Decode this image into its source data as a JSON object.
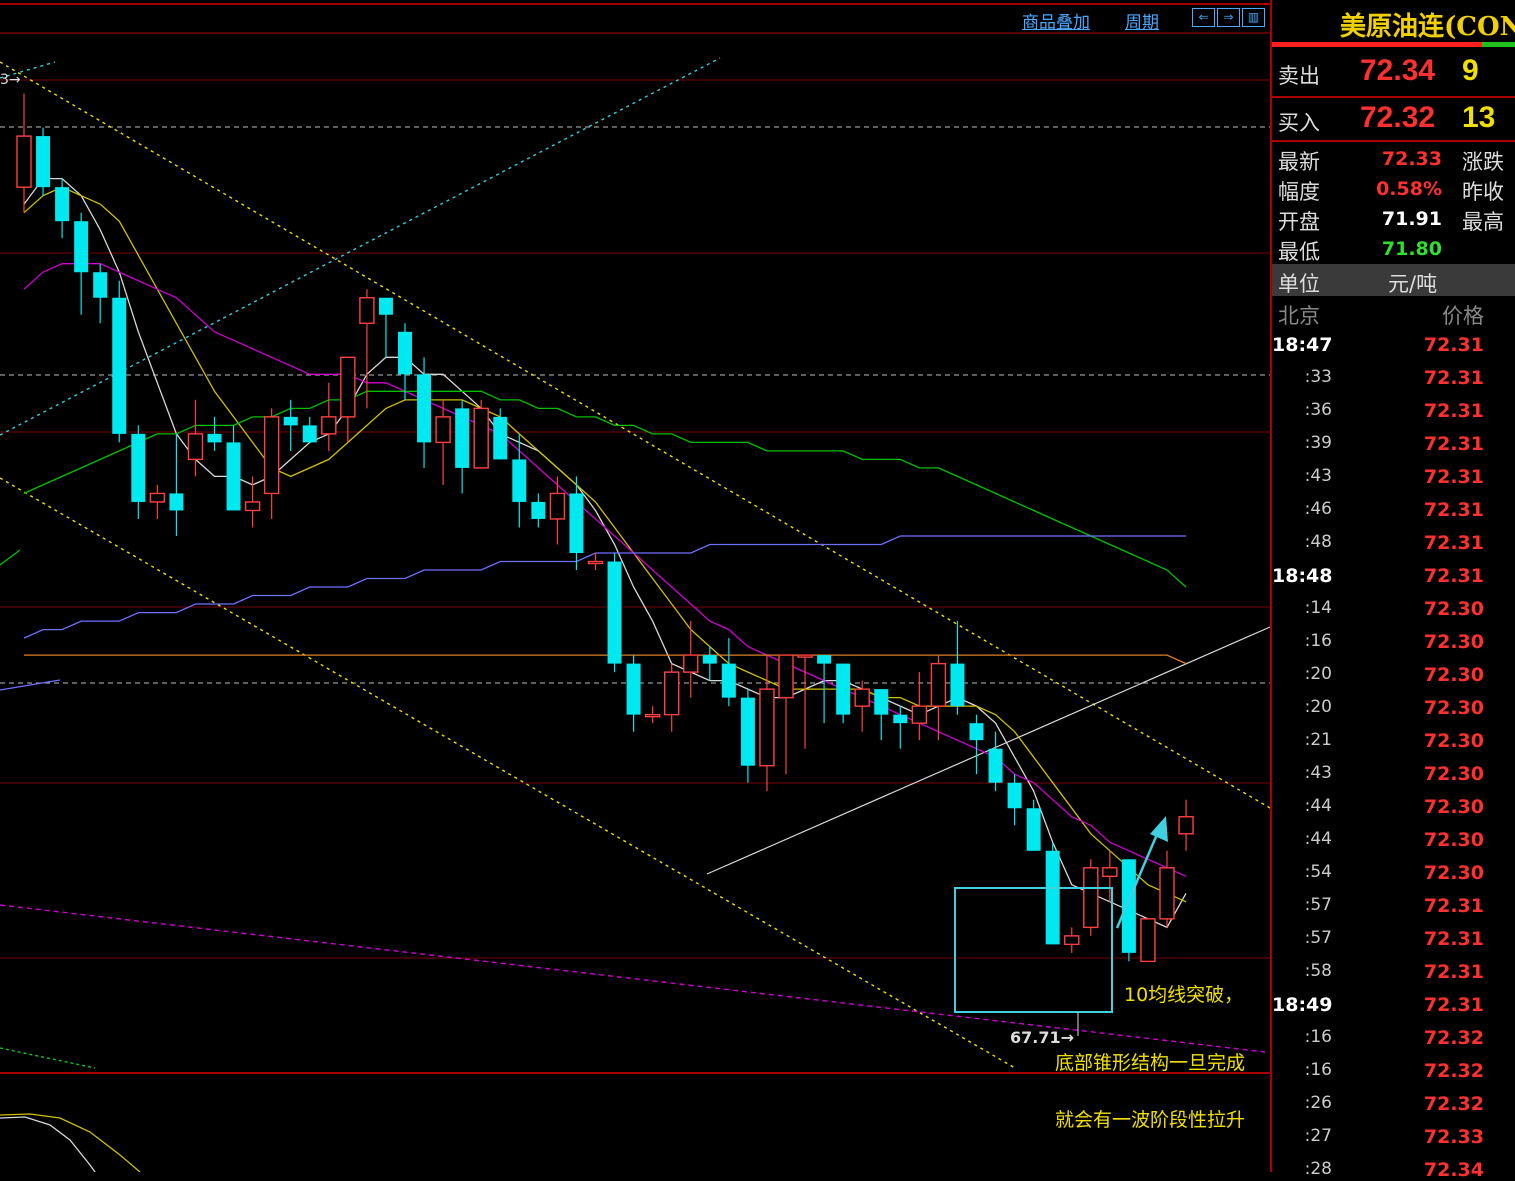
{
  "toolbar": {
    "overlay_label": "商品叠加",
    "period_label": "周期"
  },
  "chart": {
    "low_marker": "67.71→",
    "annotations": [
      "10均线突破，",
      "底部锥形结构一旦完成",
      "就会有一波阶段性拉升"
    ],
    "colors": {
      "up": "#ff4040",
      "down": "#00e8f0",
      "ma5": "#d8d8d8",
      "ma10": "#d0c000",
      "ma20": "#d000d0",
      "ma60": "#00c000",
      "ma120": "#7070ff",
      "ma250": "#e08020",
      "channel": "#f0e000",
      "box": "#40d0e0"
    }
  },
  "chart_data": {
    "type": "candlestick",
    "ylim": [
      66.4,
      78.6
    ],
    "candles": [
      [
        76.8,
        77.4,
        76.5,
        77.9
      ],
      [
        77.4,
        76.8,
        76.7,
        77.5
      ],
      [
        76.8,
        76.4,
        76.2,
        76.9
      ],
      [
        76.4,
        75.8,
        75.3,
        76.5
      ],
      [
        75.8,
        75.5,
        75.2,
        75.9
      ],
      [
        75.5,
        73.9,
        73.8,
        75.7
      ],
      [
        73.9,
        73.1,
        72.9,
        74.0
      ],
      [
        73.1,
        73.2,
        72.9,
        73.3
      ],
      [
        73.2,
        73.0,
        72.7,
        73.9
      ],
      [
        73.6,
        73.9,
        73.4,
        74.3
      ],
      [
        73.9,
        73.8,
        73.7,
        74.1
      ],
      [
        73.8,
        73.0,
        73.0,
        74.0
      ],
      [
        73.0,
        73.1,
        72.8,
        73.4
      ],
      [
        73.2,
        74.1,
        72.9,
        74.2
      ],
      [
        74.1,
        74.0,
        73.7,
        74.3
      ],
      [
        74.0,
        73.8,
        73.8,
        74.1
      ],
      [
        73.9,
        74.1,
        73.7,
        74.5
      ],
      [
        74.1,
        74.8,
        73.8,
        74.8
      ],
      [
        75.2,
        75.5,
        74.2,
        75.6
      ],
      [
        75.5,
        75.3,
        74.8,
        75.5
      ],
      [
        75.1,
        74.6,
        74.3,
        75.2
      ],
      [
        74.6,
        73.8,
        73.5,
        74.8
      ],
      [
        73.8,
        74.1,
        73.3,
        74.3
      ],
      [
        74.2,
        73.5,
        73.2,
        74.3
      ],
      [
        73.5,
        74.2,
        73.5,
        74.3
      ],
      [
        74.1,
        73.6,
        73.6,
        74.2
      ],
      [
        73.6,
        73.1,
        72.8,
        73.9
      ],
      [
        73.1,
        72.9,
        72.8,
        73.2
      ],
      [
        72.9,
        73.2,
        72.6,
        73.4
      ],
      [
        73.2,
        72.5,
        72.3,
        73.4
      ],
      [
        72.4,
        72.4,
        72.3,
        72.5
      ],
      [
        72.4,
        71.2,
        71.1,
        72.5
      ],
      [
        71.2,
        70.6,
        70.4,
        71.3
      ],
      [
        70.6,
        70.6,
        70.5,
        70.7
      ],
      [
        70.6,
        71.1,
        70.4,
        71.2
      ],
      [
        71.1,
        71.3,
        70.8,
        71.7
      ],
      [
        71.3,
        71.2,
        71.0,
        71.4
      ],
      [
        71.2,
        70.8,
        70.7,
        71.5
      ],
      [
        70.8,
        70.0,
        69.8,
        70.9
      ],
      [
        70.0,
        70.9,
        69.7,
        71.3
      ],
      [
        70.8,
        71.3,
        69.9,
        71.3
      ],
      [
        71.3,
        71.3,
        70.2,
        71.3
      ],
      [
        71.3,
        71.2,
        70.5,
        71.3
      ],
      [
        71.2,
        70.6,
        70.5,
        71.2
      ],
      [
        70.7,
        70.9,
        70.4,
        71.0
      ],
      [
        70.9,
        70.6,
        70.3,
        70.9
      ],
      [
        70.6,
        70.5,
        70.2,
        70.7
      ],
      [
        70.5,
        70.7,
        70.3,
        71.1
      ],
      [
        70.7,
        71.2,
        70.3,
        71.3
      ],
      [
        71.2,
        70.7,
        70.6,
        71.7
      ],
      [
        70.5,
        70.3,
        69.9,
        70.6
      ],
      [
        70.2,
        69.8,
        69.7,
        70.4
      ],
      [
        69.8,
        69.5,
        69.3,
        69.9
      ],
      [
        69.5,
        69.0,
        69.0,
        69.6
      ],
      [
        69.0,
        67.9,
        67.9,
        69.1
      ],
      [
        67.9,
        68.0,
        67.8,
        68.1
      ],
      [
        68.1,
        68.8,
        68.0,
        68.9
      ],
      [
        68.7,
        68.8,
        68.4,
        69.0
      ],
      [
        68.9,
        67.8,
        67.7,
        68.9
      ],
      [
        67.7,
        68.2,
        67.7,
        68.2
      ],
      [
        68.2,
        68.8,
        68.1,
        69.0
      ],
      [
        69.2,
        69.4,
        69.0,
        69.6
      ]
    ],
    "ma_series": [
      {
        "name": "MA5",
        "color": "#d8d8d8",
        "values": [
          76.6,
          76.9,
          76.9,
          76.7,
          76.3,
          75.8,
          75.1,
          74.5,
          73.9,
          73.6,
          73.4,
          73.4,
          73.3,
          73.4,
          73.6,
          73.8,
          73.9,
          74.2,
          74.6,
          74.8,
          74.8,
          74.6,
          74.6,
          74.4,
          74.2,
          73.9,
          73.8,
          73.7,
          73.5,
          73.3,
          73.0,
          72.6,
          72.1,
          71.7,
          71.2,
          71.1,
          71.0,
          71.0,
          70.9,
          70.8,
          70.8,
          70.9,
          71.0,
          71.0,
          70.9,
          70.8,
          70.7,
          70.6,
          70.7,
          70.8,
          70.7,
          70.5,
          70.1,
          69.7,
          69.1,
          68.6,
          68.5,
          68.4,
          68.3,
          68.2,
          68.1,
          68.5
        ]
      },
      {
        "name": "MA10",
        "color": "#d0c000",
        "values": [
          76.5,
          76.7,
          76.8,
          76.7,
          76.6,
          76.4,
          76.0,
          75.6,
          75.2,
          74.8,
          74.4,
          74.1,
          73.8,
          73.5,
          73.4,
          73.5,
          73.6,
          73.8,
          74.0,
          74.2,
          74.3,
          74.3,
          74.3,
          74.3,
          74.2,
          74.1,
          73.9,
          73.7,
          73.5,
          73.3,
          73.1,
          72.8,
          72.5,
          72.2,
          71.9,
          71.6,
          71.4,
          71.2,
          71.1,
          71.0,
          70.9,
          70.9,
          70.9,
          70.9,
          70.9,
          70.8,
          70.8,
          70.7,
          70.7,
          70.7,
          70.7,
          70.6,
          70.4,
          70.1,
          69.8,
          69.5,
          69.2,
          69.0,
          68.8,
          68.6,
          68.5,
          68.4
        ]
      },
      {
        "name": "MA20",
        "color": "#d000d0",
        "values": [
          75.6,
          75.8,
          75.9,
          75.9,
          75.9,
          75.8,
          75.7,
          75.6,
          75.5,
          75.3,
          75.1,
          75.0,
          74.9,
          74.8,
          74.7,
          74.6,
          74.6,
          74.6,
          74.5,
          74.5,
          74.4,
          74.3,
          74.2,
          74.1,
          74.0,
          73.9,
          73.7,
          73.5,
          73.3,
          73.1,
          72.9,
          72.7,
          72.5,
          72.3,
          72.1,
          71.9,
          71.7,
          71.6,
          71.4,
          71.3,
          71.2,
          71.1,
          71.0,
          70.9,
          70.8,
          70.7,
          70.6,
          70.5,
          70.4,
          70.3,
          70.2,
          70.1,
          69.9,
          69.8,
          69.6,
          69.4,
          69.3,
          69.1,
          69.0,
          68.9,
          68.8,
          68.7
        ]
      },
      {
        "name": "MA60",
        "color": "#00c000",
        "values": [
          73.2,
          73.3,
          73.4,
          73.5,
          73.6,
          73.7,
          73.8,
          73.9,
          73.9,
          74.0,
          74.0,
          74.0,
          74.1,
          74.1,
          74.2,
          74.2,
          74.3,
          74.3,
          74.4,
          74.4,
          74.4,
          74.4,
          74.4,
          74.4,
          74.4,
          74.3,
          74.3,
          74.2,
          74.2,
          74.1,
          74.1,
          74.0,
          74.0,
          73.9,
          73.9,
          73.8,
          73.8,
          73.8,
          73.8,
          73.7,
          73.7,
          73.7,
          73.7,
          73.7,
          73.6,
          73.6,
          73.6,
          73.5,
          73.5,
          73.4,
          73.3,
          73.2,
          73.1,
          73.0,
          72.9,
          72.8,
          72.7,
          72.6,
          72.5,
          72.4,
          72.3,
          72.1
        ]
      },
      {
        "name": "MA120",
        "color": "#7070ff",
        "values": [
          71.5,
          71.6,
          71.6,
          71.7,
          71.7,
          71.7,
          71.8,
          71.8,
          71.8,
          71.9,
          71.9,
          71.9,
          72.0,
          72.0,
          72.0,
          72.1,
          72.1,
          72.1,
          72.2,
          72.2,
          72.2,
          72.3,
          72.3,
          72.3,
          72.3,
          72.4,
          72.4,
          72.4,
          72.4,
          72.4,
          72.5,
          72.5,
          72.5,
          72.5,
          72.5,
          72.5,
          72.6,
          72.6,
          72.6,
          72.6,
          72.6,
          72.6,
          72.6,
          72.6,
          72.6,
          72.6,
          72.7,
          72.7,
          72.7,
          72.7,
          72.7,
          72.7,
          72.7,
          72.7,
          72.7,
          72.7,
          72.7,
          72.7,
          72.7,
          72.7,
          72.7,
          72.7
        ]
      },
      {
        "name": "MA250",
        "color": "#e08020",
        "values": [
          71.3,
          71.3,
          71.3,
          71.3,
          71.3,
          71.3,
          71.3,
          71.3,
          71.3,
          71.3,
          71.3,
          71.3,
          71.3,
          71.3,
          71.3,
          71.3,
          71.3,
          71.3,
          71.3,
          71.3,
          71.3,
          71.3,
          71.3,
          71.3,
          71.3,
          71.3,
          71.3,
          71.3,
          71.3,
          71.3,
          71.3,
          71.3,
          71.3,
          71.3,
          71.3,
          71.3,
          71.3,
          71.3,
          71.3,
          71.3,
          71.3,
          71.3,
          71.3,
          71.3,
          71.3,
          71.3,
          71.3,
          71.3,
          71.3,
          71.3,
          71.3,
          71.3,
          71.3,
          71.3,
          71.3,
          71.3,
          71.3,
          71.3,
          71.3,
          71.3,
          71.3,
          71.2
        ]
      }
    ]
  },
  "quote": {
    "title": "美原油连(CON",
    "sell_label": "卖出",
    "sell_price": "72.34",
    "sell_qty": "9",
    "buy_label": "买入",
    "buy_price": "72.32",
    "buy_qty": "13",
    "rows": [
      {
        "l1": "最新",
        "v1": "72.33",
        "c1": "#ff3030",
        "l2": "涨跌"
      },
      {
        "l1": "幅度",
        "v1": "0.58%",
        "c1": "#ff3030",
        "l2": "昨收"
      },
      {
        "l1": "开盘",
        "v1": "71.91",
        "c1": "#ffffff",
        "l2": "最高"
      },
      {
        "l1": "最低",
        "v1": "71.80",
        "c1": "#30e030",
        "l2": ""
      }
    ],
    "unit_label": "单位",
    "unit_value": "元/吨",
    "tick_header_time": "北京",
    "tick_header_price": "价格",
    "ticks": [
      {
        "t": "18:47",
        "p": "72.31",
        "bold": true
      },
      {
        "t": ":33",
        "p": "72.31"
      },
      {
        "t": ":36",
        "p": "72.31"
      },
      {
        "t": ":39",
        "p": "72.31"
      },
      {
        "t": ":43",
        "p": "72.31"
      },
      {
        "t": ":46",
        "p": "72.31"
      },
      {
        "t": ":48",
        "p": "72.31"
      },
      {
        "t": "18:48",
        "p": "72.31",
        "bold": true
      },
      {
        "t": ":14",
        "p": "72.30"
      },
      {
        "t": ":16",
        "p": "72.30"
      },
      {
        "t": ":20",
        "p": "72.30"
      },
      {
        "t": ":20",
        "p": "72.30"
      },
      {
        "t": ":21",
        "p": "72.30"
      },
      {
        "t": ":43",
        "p": "72.30"
      },
      {
        "t": ":44",
        "p": "72.30"
      },
      {
        "t": ":44",
        "p": "72.30"
      },
      {
        "t": ":54",
        "p": "72.30"
      },
      {
        "t": ":57",
        "p": "72.31"
      },
      {
        "t": ":57",
        "p": "72.31"
      },
      {
        "t": ":58",
        "p": "72.31"
      },
      {
        "t": "18:49",
        "p": "72.31",
        "bold": true
      },
      {
        "t": ":16",
        "p": "72.32"
      },
      {
        "t": ":16",
        "p": "72.32"
      },
      {
        "t": ":26",
        "p": "72.32"
      },
      {
        "t": ":27",
        "p": "72.33"
      },
      {
        "t": ":28",
        "p": "72.34"
      }
    ]
  }
}
